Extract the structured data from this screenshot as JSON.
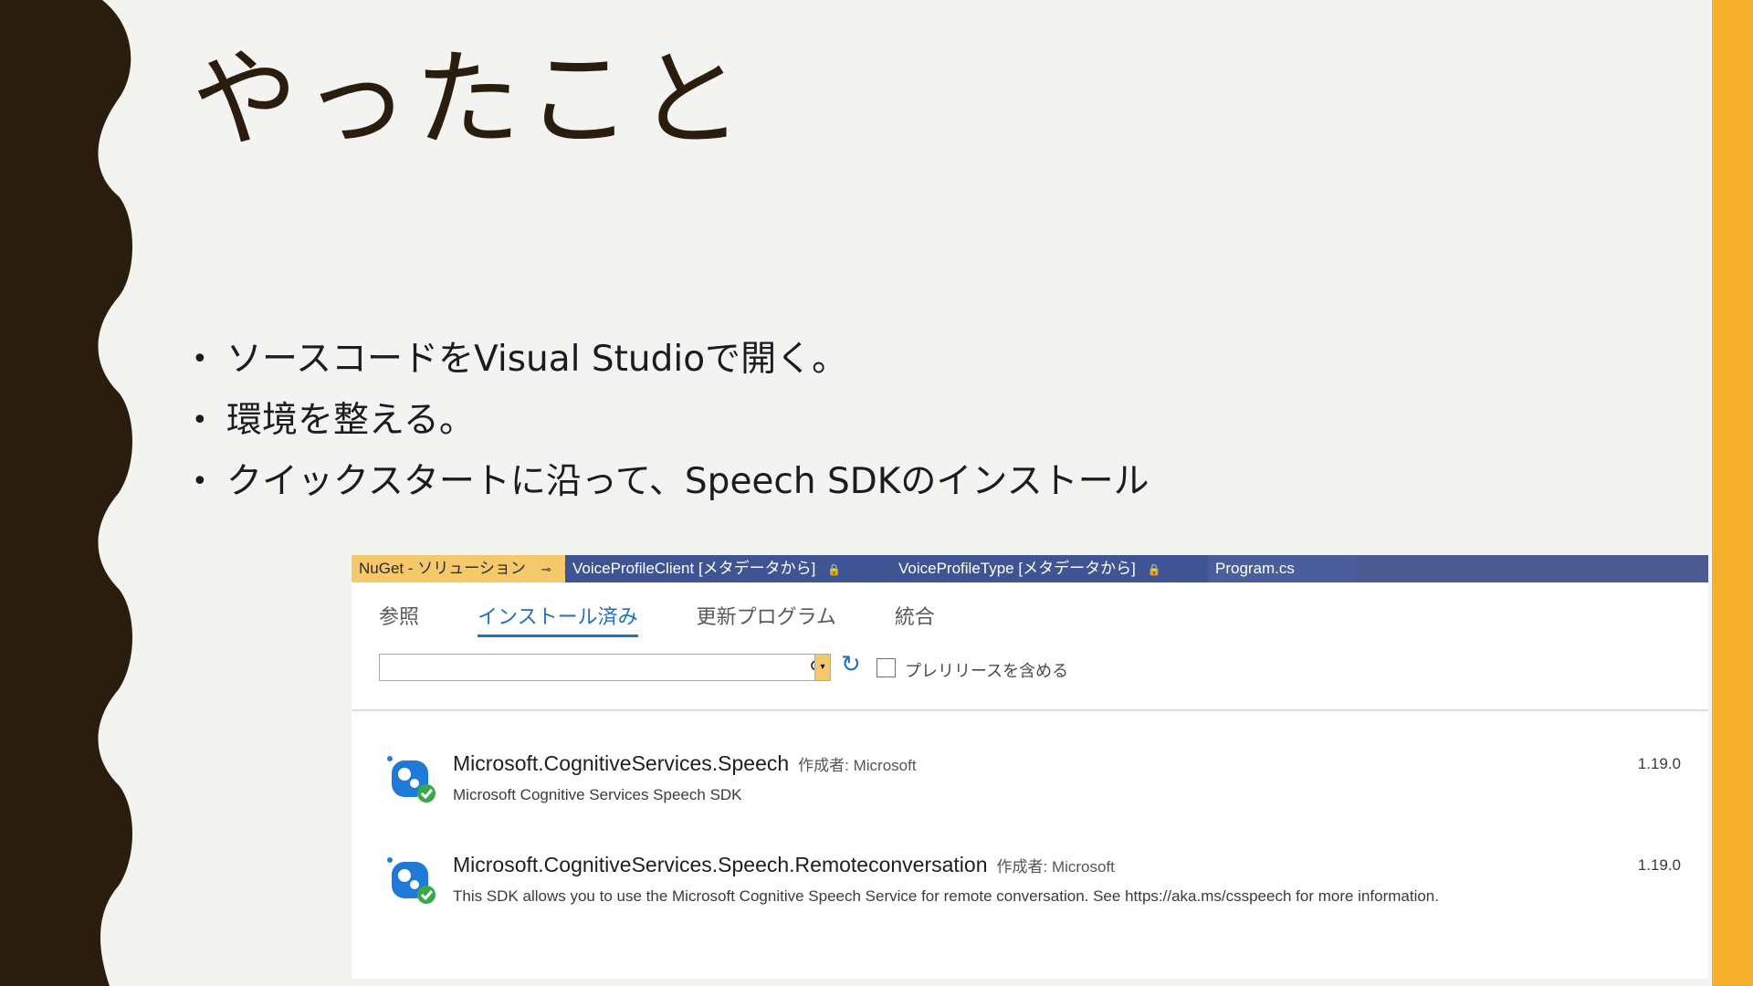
{
  "slide": {
    "title": "やったこと",
    "bullets": [
      "ソースコードをVisual Studioで開く。",
      "環境を整える。",
      "クイックスタートに沿って、Speech SDKのインストール"
    ]
  },
  "colors": {
    "accent_right": "#f4b02a",
    "left_band": "#2b1d0e",
    "background": "#f3f3f1",
    "tab_bar": "#4b5b8f",
    "active_tab": "#f5c96a",
    "link_blue": "#1f6fc4"
  },
  "nuget": {
    "doc_tabs": [
      {
        "label": "NuGet - ソリューション",
        "active": true
      },
      {
        "label": "VoiceProfileClient [メタデータから]"
      },
      {
        "label": "VoiceProfileType [メタデータから]"
      },
      {
        "label": "Program.cs"
      }
    ],
    "pin_icon": "pin-icon",
    "close_icon": "close-icon",
    "lock_icon": "lock-icon",
    "sub_tabs": [
      {
        "label": "参照"
      },
      {
        "label": "インストール済み",
        "active": true
      },
      {
        "label": "更新プログラム"
      },
      {
        "label": "統合"
      }
    ],
    "search": {
      "value": "",
      "placeholder": ""
    },
    "prerelease_label": "プレリリースを含める",
    "packages": [
      {
        "name": "Microsoft.CognitiveServices.Speech",
        "author": "作成者: Microsoft",
        "description": "Microsoft Cognitive Services Speech SDK",
        "version": "1.19.0",
        "installed": true
      },
      {
        "name": "Microsoft.CognitiveServices.Speech.Remoteconversation",
        "author": "作成者: Microsoft",
        "description": "This SDK allows you to use the Microsoft Cognitive Speech Service for remote conversation. See https://aka.ms/csspeech for more information.",
        "version": "1.19.0",
        "installed": true
      }
    ]
  }
}
